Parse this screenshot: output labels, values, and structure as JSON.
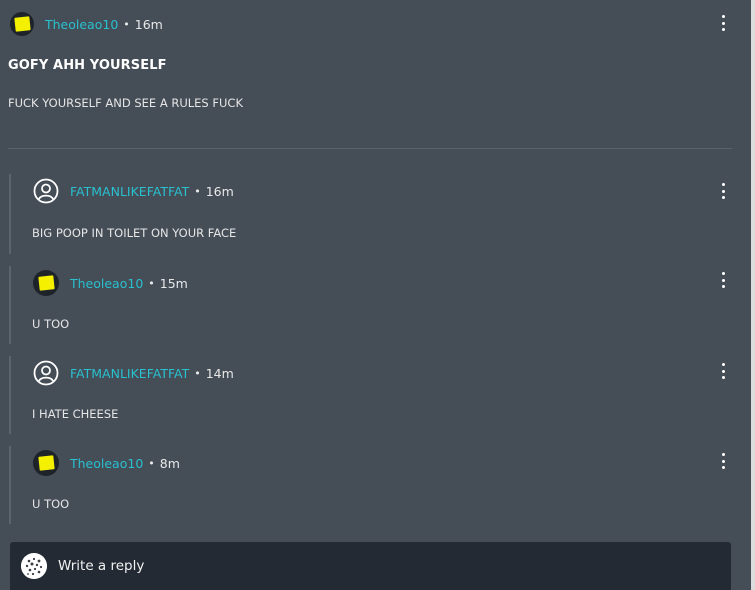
{
  "post": {
    "author": "Theoleao10",
    "separator": "•",
    "time": "16m",
    "title": "GOFY AHH YOURSELF",
    "body": "FUCK YOURSELF AND SEE A RULES FUCK",
    "avatar_icon": "yellow-square-avatar"
  },
  "replies": [
    {
      "author": "FATMANLIKEFATFAT",
      "separator": "•",
      "time": "16m",
      "text": "BIG POOP IN TOILET ON YOUR FACE",
      "avatar_icon": "default-user-icon"
    },
    {
      "author": "Theoleao10",
      "separator": "•",
      "time": "15m",
      "text": "U TOO",
      "avatar_icon": "yellow-square-avatar"
    },
    {
      "author": "FATMANLIKEFATFAT",
      "separator": "•",
      "time": "14m",
      "text": "I HATE CHEESE",
      "avatar_icon": "default-user-icon"
    },
    {
      "author": "Theoleao10",
      "separator": "•",
      "time": "8m",
      "text": "U TOO",
      "avatar_icon": "yellow-square-avatar"
    }
  ],
  "reply_box": {
    "placeholder": "Write a reply",
    "avatar_icon": "dotted-avatar"
  },
  "colors": {
    "background": "#454d57",
    "username": "#29c0cf",
    "reply_box": "#232a33",
    "avatar_yellow": "#f4f000"
  }
}
